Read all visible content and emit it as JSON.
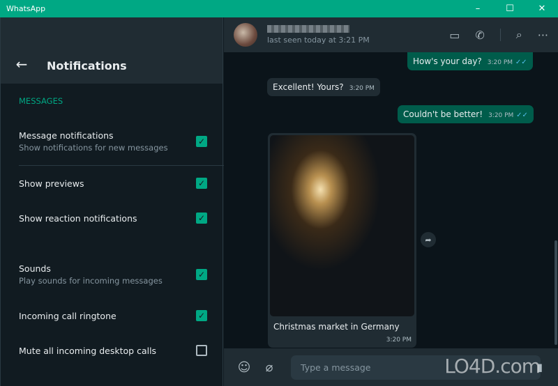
{
  "window": {
    "title": "WhatsApp",
    "controls": [
      "–",
      "☐",
      "✕"
    ]
  },
  "settings": {
    "title": "Notifications",
    "section": "MESSAGES",
    "items": [
      {
        "label": "Message notifications",
        "sub": "Show notifications for new messages",
        "checked": true
      },
      {
        "label": "Show previews",
        "checked": true
      },
      {
        "label": "Show reaction notifications",
        "checked": true
      },
      {
        "label": "Sounds",
        "sub": "Play sounds for incoming messages",
        "checked": true
      },
      {
        "label": "Incoming call ringtone",
        "checked": true
      },
      {
        "label": "Mute all incoming desktop calls",
        "checked": false
      }
    ]
  },
  "chat": {
    "status": "last seen today at 3:21 PM",
    "messages": [
      {
        "text": "How's your day?",
        "time": "3:20 PM",
        "dir": "out"
      },
      {
        "text": "Excellent! Yours?",
        "time": "3:20 PM",
        "dir": "in"
      },
      {
        "text": "Couldn't be better!",
        "time": "3:20 PM",
        "dir": "out"
      }
    ],
    "image_message": {
      "caption": "Christmas market in Germany",
      "time": "3:20 PM"
    },
    "input_placeholder": "Type a message",
    "ticks": "✓✓"
  },
  "watermark": "LO4D.com",
  "colors": {
    "accent": "#00a884",
    "outgoing": "#005c4b",
    "incoming": "#202c33"
  }
}
